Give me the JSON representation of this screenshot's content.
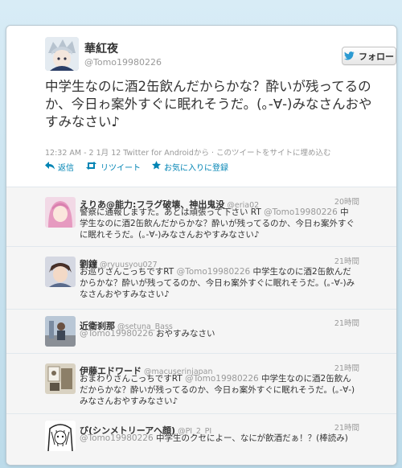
{
  "colors": {
    "background": "#c0deed",
    "link": "#0084b4",
    "muted": "#999999",
    "reply_bg": "#f5f5f5"
  },
  "author": {
    "name": "華紅夜",
    "handle": "@Tomo19980226"
  },
  "follow_button": {
    "label": "フォロー",
    "icon": "twitter-bird-icon"
  },
  "tweet": {
    "text": "中学生なのに酒2缶飲んだからかな？酔いが残ってるのか、今日ゎ案外すぐに眠れそうだ。(｡-∀-)みなさんおやすみなさい♪",
    "meta": "12:32 AM - 2 1月 12 Twitter for Androidから · このツイートをサイトに埋め込む"
  },
  "actions": {
    "reply": {
      "label": "返信",
      "icon": "reply-arrow-icon"
    },
    "retweet": {
      "label": "リツイート",
      "icon": "retweet-icon"
    },
    "favorite": {
      "label": "お気に入りに登録",
      "icon": "star-icon"
    }
  },
  "replies": [
    {
      "name": "えりあ@能力:フラグ破壊、神出鬼没",
      "handle": "@eria02",
      "time": "20時間",
      "text_before": "警察に通報しますた。あとは頑張って下さい RT ",
      "mention": "@Tomo19980226",
      "text_after": " 中学生なのに酒2缶飲んだからかな？酔いが残ってるのか、今日ゎ案外すぐに眠れそうだ。(｡-∀-)みなさんおやすみなさい♪"
    },
    {
      "name": "劉鐘",
      "handle": "@ryuusyou027",
      "time": "21時間",
      "text_before": "お巡りさんこっちですRT ",
      "mention": "@Tomo19980226",
      "text_after": " 中学生なのに酒2缶飲んだからかな？酔いが残ってるのか、今日ゎ案外すぐに眠れそうだ。(｡-∀-)みなさんおやすみなさい♪"
    },
    {
      "name": "近衛刹那",
      "handle": "@setuna_Bass",
      "time": "21時間",
      "text_before": "",
      "mention": "@Tomo19980226",
      "text_after": " おやすみなさい"
    },
    {
      "name": "伊藤エドワード",
      "handle": "@macuserinjapan",
      "time": "21時間",
      "text_before": "おまわりさんこっちですRT ",
      "mention": "@Tomo19980226",
      "text_after": " 中学生なのに酒2缶飲んだからかな？酔いが残ってるのか、今日ゎ案外すぐに眠れそうだ。(｡-∀-)みなさんおやすみなさい♪"
    },
    {
      "name": "び(シンメトリーアヘ顔)",
      "handle": "@PI_2_PI",
      "time": "21時間",
      "text_before": "",
      "mention": "@Tomo19980226",
      "text_after": " 中学生のクセによー、なにが飲酒だぁ！？(棒読み)"
    }
  ]
}
